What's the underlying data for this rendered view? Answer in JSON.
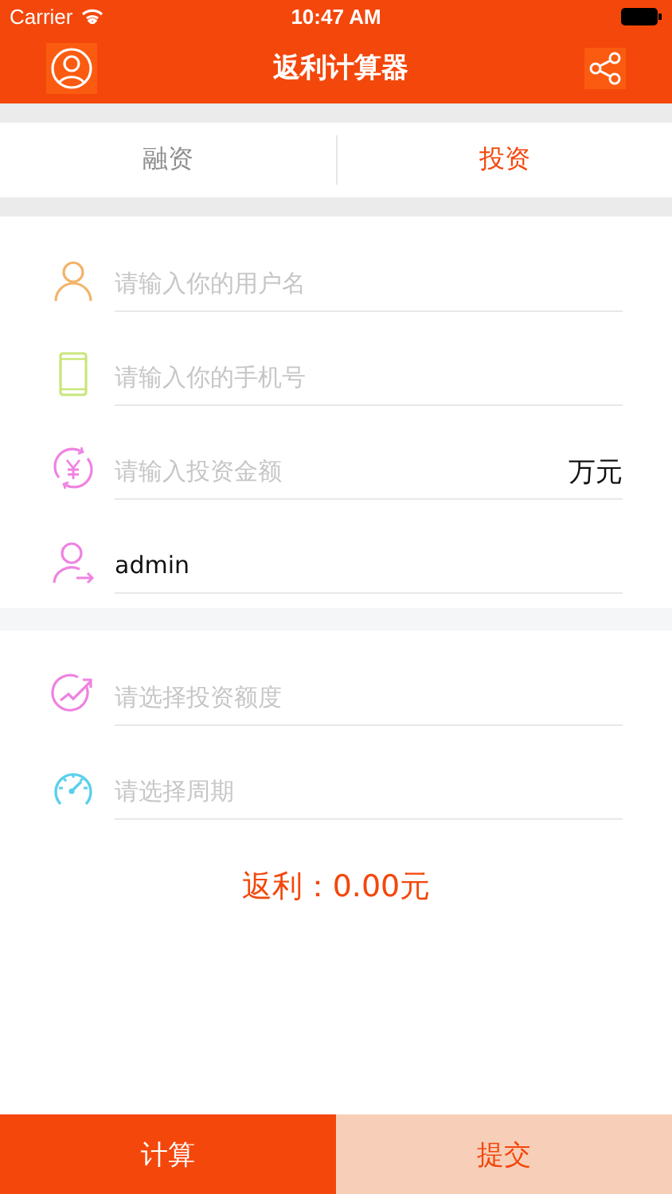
{
  "status_bar": {
    "carrier": "Carrier",
    "time": "10:47 AM"
  },
  "nav": {
    "title": "返利计算器"
  },
  "tabs": [
    {
      "label": "融资",
      "selected": false
    },
    {
      "label": "投资",
      "selected": true
    }
  ],
  "groups": [
    [
      {
        "placeholder": "请输入你的用户名"
      },
      {
        "placeholder": "请输入你的手机号"
      },
      {
        "placeholder": "请输入投资金额",
        "unit": "万元"
      },
      {
        "value": "admin"
      }
    ],
    [
      {
        "placeholder": "请选择投资额度"
      },
      {
        "placeholder": "请选择周期"
      }
    ]
  ],
  "result": "返利：0.00元",
  "buttons": [
    {
      "label": "计算",
      "kind": "primary"
    },
    {
      "label": "提交",
      "kind": "secondary"
    }
  ]
}
